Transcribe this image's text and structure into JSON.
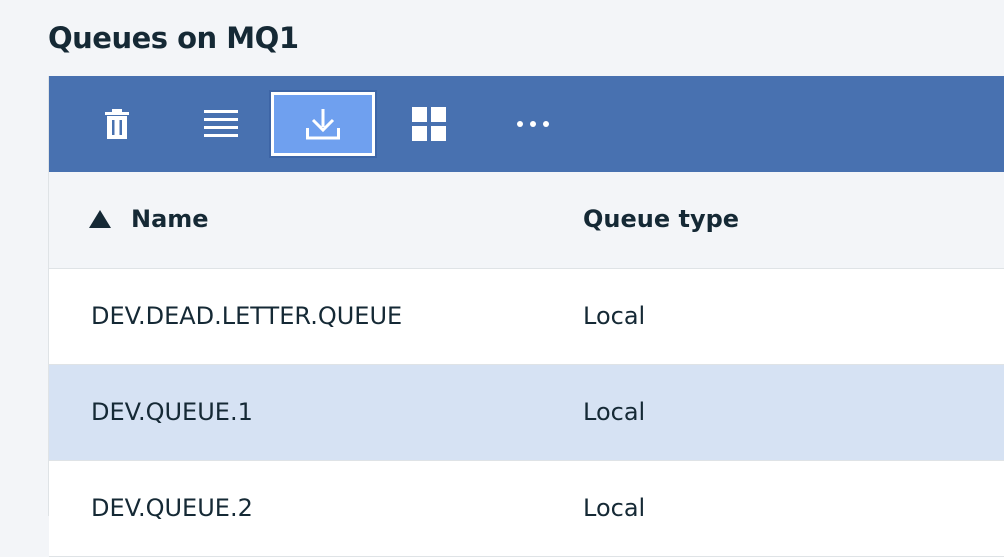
{
  "page": {
    "title": "Queues on MQ1"
  },
  "toolbar": {
    "buttons": [
      {
        "icon": "trash-icon"
      },
      {
        "icon": "list-view-icon"
      },
      {
        "icon": "download-icon",
        "active": true
      },
      {
        "icon": "grid-view-icon"
      },
      {
        "icon": "overflow-menu-icon"
      }
    ]
  },
  "table": {
    "columns": [
      "Name",
      "Queue type"
    ],
    "sort": {
      "column": "Name",
      "direction": "ascending"
    },
    "rows": [
      {
        "name": "DEV.DEAD.LETTER.QUEUE",
        "type": "Local",
        "selected": false
      },
      {
        "name": "DEV.QUEUE.1",
        "type": "Local",
        "selected": true
      },
      {
        "name": "DEV.QUEUE.2",
        "type": "Local",
        "selected": false
      }
    ]
  },
  "colors": {
    "toolbar": "#4871b0",
    "active_button": "#6fa0ef",
    "selected_row": "#d6e2f3"
  }
}
